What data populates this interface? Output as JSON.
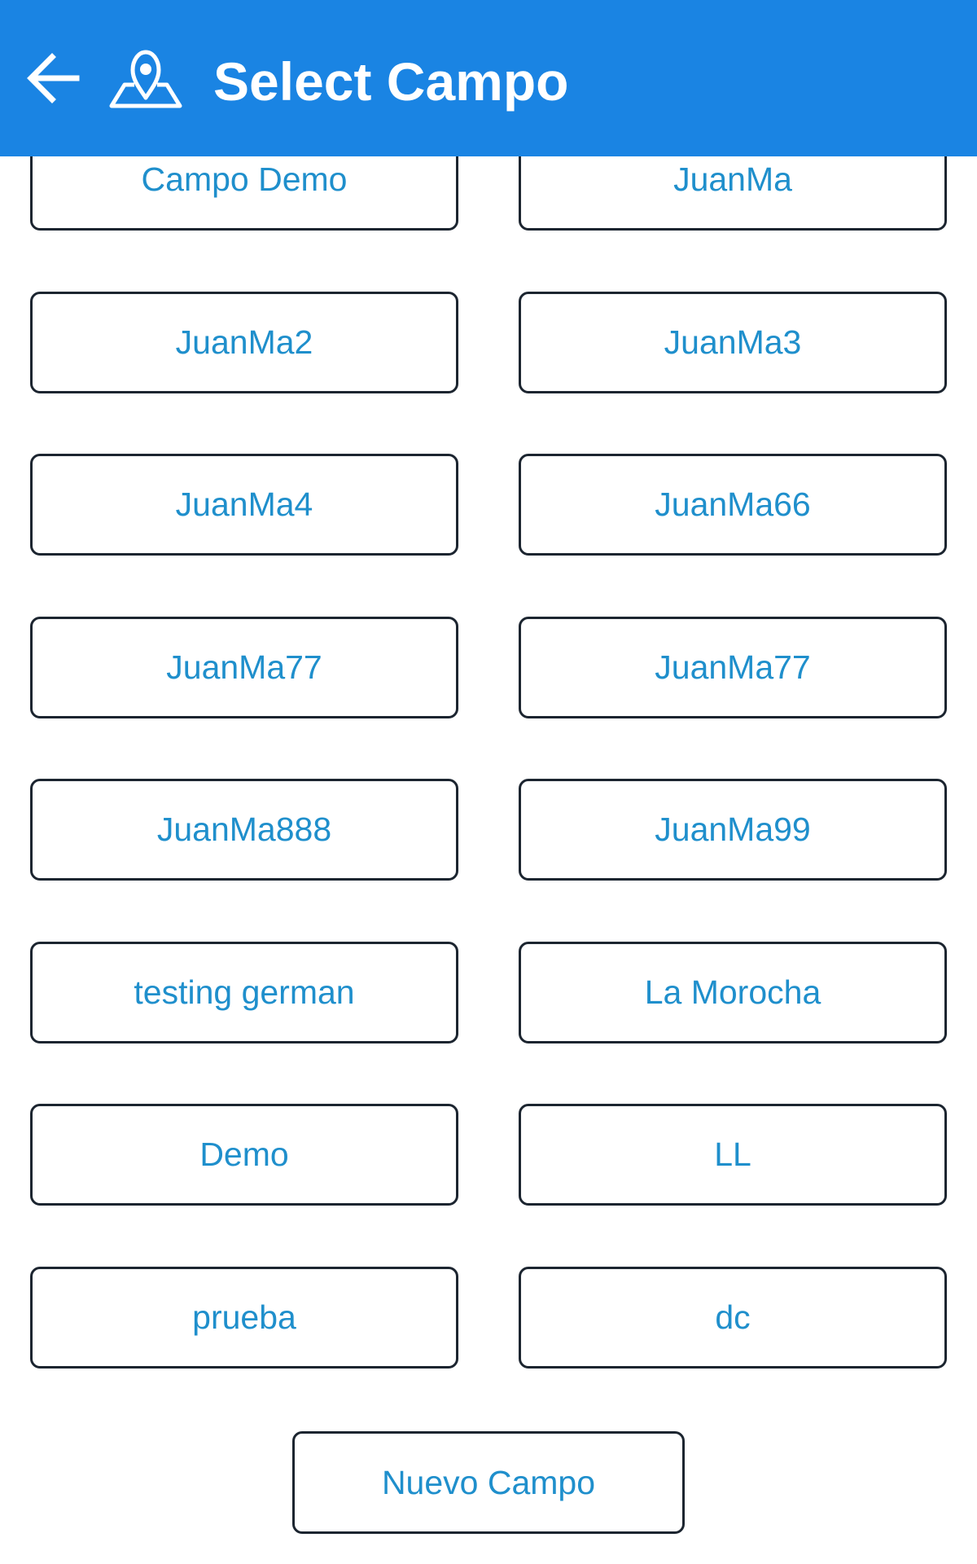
{
  "app_bar": {
    "title": "Select Campo",
    "back_icon": "arrow-left-icon",
    "title_icon": "map-pin-icon",
    "background_color": "#1a84e3"
  },
  "campos": [
    {
      "label": "Campo Demo"
    },
    {
      "label": "JuanMa"
    },
    {
      "label": "JuanMa2"
    },
    {
      "label": "JuanMa3"
    },
    {
      "label": "JuanMa4"
    },
    {
      "label": "JuanMa66"
    },
    {
      "label": "JuanMa77"
    },
    {
      "label": "JuanMa77"
    },
    {
      "label": "JuanMa888"
    },
    {
      "label": "JuanMa99"
    },
    {
      "label": "testing german"
    },
    {
      "label": "La Morocha"
    },
    {
      "label": "Demo"
    },
    {
      "label": "LL"
    },
    {
      "label": "prueba"
    },
    {
      "label": "dc"
    }
  ],
  "nuevo_campo": {
    "label": "Nuevo Campo"
  },
  "colors": {
    "button_text": "#1f8fcc",
    "button_border": "#1c2530"
  }
}
